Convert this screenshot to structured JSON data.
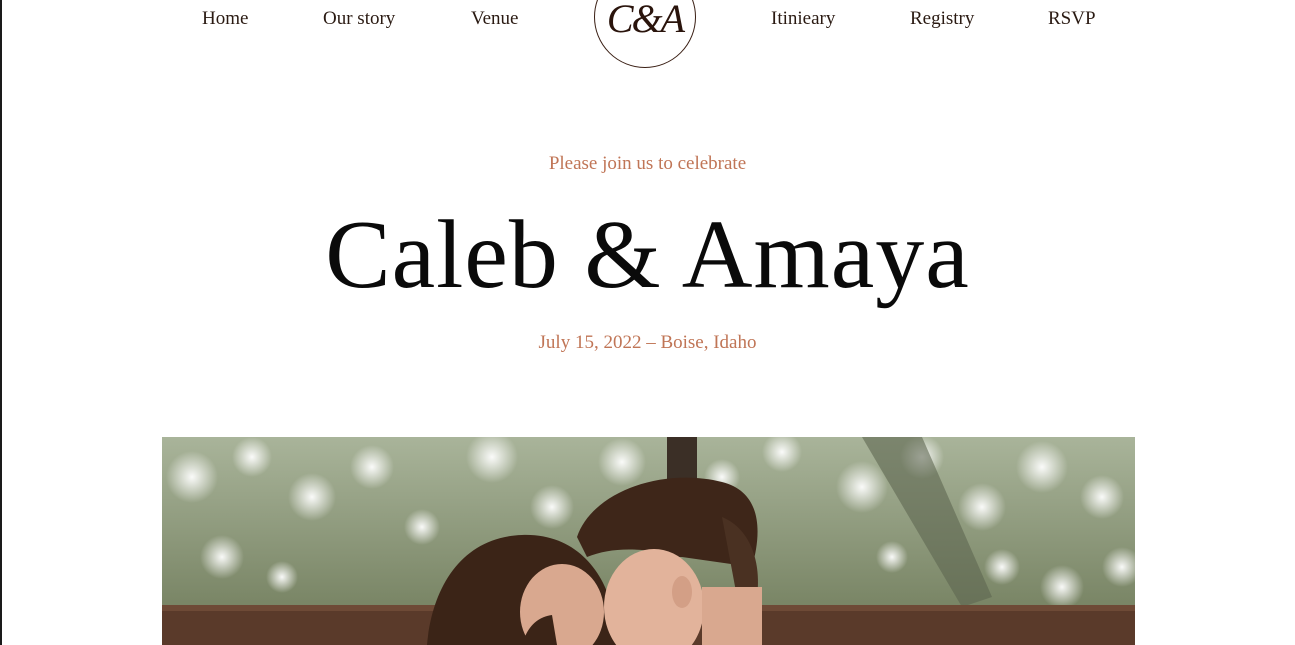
{
  "nav": {
    "left": [
      "Home",
      "Our story",
      "Venue"
    ],
    "logo": "C&A",
    "right": [
      "Itinieary",
      "Registry",
      "RSVP"
    ]
  },
  "hero": {
    "invite": "Please join us to celebrate",
    "names": "Caleb & Amaya",
    "date_location": "July 15, 2022 – Boise, Idaho"
  },
  "photo": {
    "subject": "couple-photo"
  },
  "colors": {
    "accent": "#c07556",
    "text": "#0a0a0a",
    "nav_text": "#2a1a12"
  }
}
